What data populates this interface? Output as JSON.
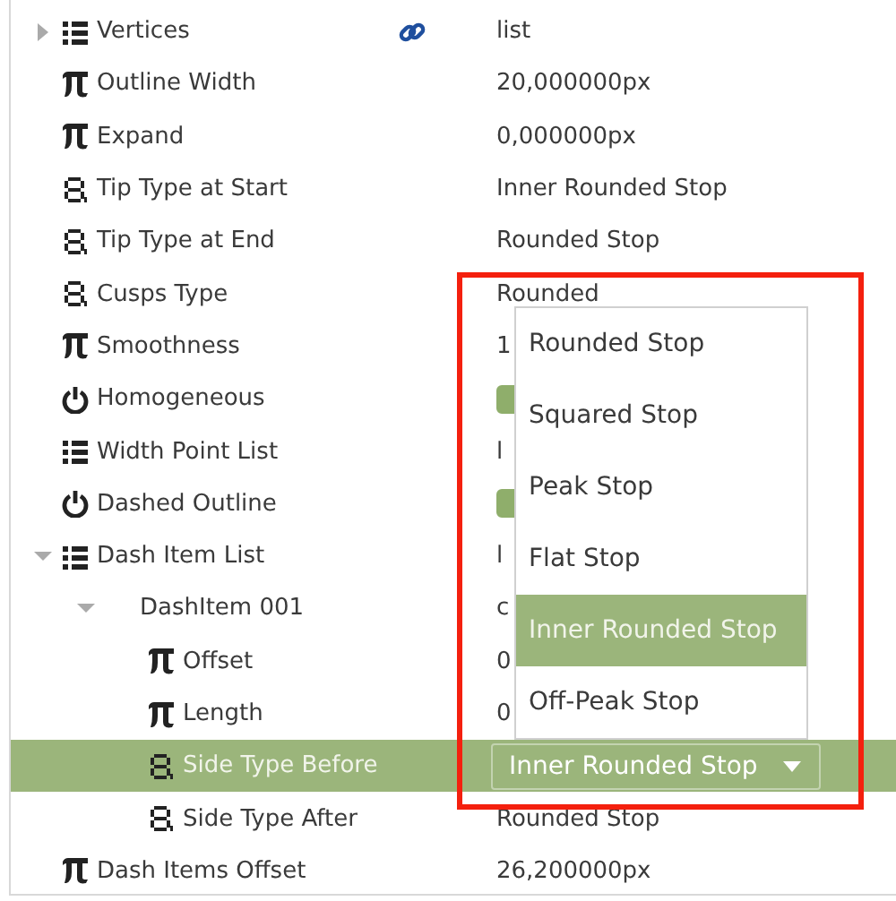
{
  "parameters": [
    {
      "label": "Vertices",
      "kind": "list",
      "value": "list",
      "linked": true,
      "selected": false,
      "expanded": false
    },
    {
      "label": "Outline Width",
      "kind": "real",
      "value": "20,000000px",
      "linked": false,
      "selected": false
    },
    {
      "label": "Expand",
      "kind": "real",
      "value": "0,000000px",
      "linked": false,
      "selected": false
    },
    {
      "label": "Tip Type at Start",
      "kind": "enum",
      "value": "Inner Rounded Stop",
      "linked": false,
      "selected": false
    },
    {
      "label": "Tip Type at End",
      "kind": "enum",
      "value": "Rounded Stop",
      "linked": false,
      "selected": false
    },
    {
      "label": "Cusps Type",
      "kind": "enum",
      "value": "Rounded",
      "linked": false,
      "selected": false
    },
    {
      "label": "Smoothness",
      "kind": "real",
      "value": "1",
      "linked": false,
      "selected": false
    },
    {
      "label": "Homogeneous",
      "kind": "bool",
      "checked": true,
      "linked": false,
      "selected": false
    },
    {
      "label": "Width Point List",
      "kind": "list",
      "value": "l",
      "linked": false,
      "selected": false
    },
    {
      "label": "Dashed Outline",
      "kind": "bool",
      "checked": true,
      "linked": false,
      "selected": false
    },
    {
      "label": "Dash Item List",
      "kind": "list",
      "value": "l",
      "linked": false,
      "selected": false,
      "expanded": true,
      "children": [
        {
          "label": "DashItem 001",
          "value": "c",
          "linked": false,
          "selected": false,
          "expanded": true,
          "children": [
            {
              "label": "Offset",
              "kind": "real",
              "value": "0",
              "linked": false,
              "selected": false
            },
            {
              "label": "Length",
              "kind": "real",
              "value": "0",
              "linked": false,
              "selected": false
            },
            {
              "label": "Side Type Before",
              "kind": "enum",
              "value": "Inner Rounded Stop",
              "linked": false,
              "selected": true
            },
            {
              "label": "Side Type After",
              "kind": "enum",
              "value": "Rounded Stop",
              "linked": false,
              "selected": false
            }
          ]
        }
      ]
    },
    {
      "label": "Dash Items Offset",
      "kind": "real",
      "value": "26,200000px",
      "linked": false,
      "selected": false
    }
  ],
  "dropdown": {
    "options": [
      {
        "label": "Rounded Stop",
        "selected": false
      },
      {
        "label": "Squared Stop",
        "selected": false
      },
      {
        "label": "Peak Stop",
        "selected": false
      },
      {
        "label": "Flat Stop",
        "selected": false
      },
      {
        "label": "Inner Rounded Stop",
        "selected": true
      },
      {
        "label": "Off-Peak Stop",
        "selected": false
      }
    ]
  }
}
